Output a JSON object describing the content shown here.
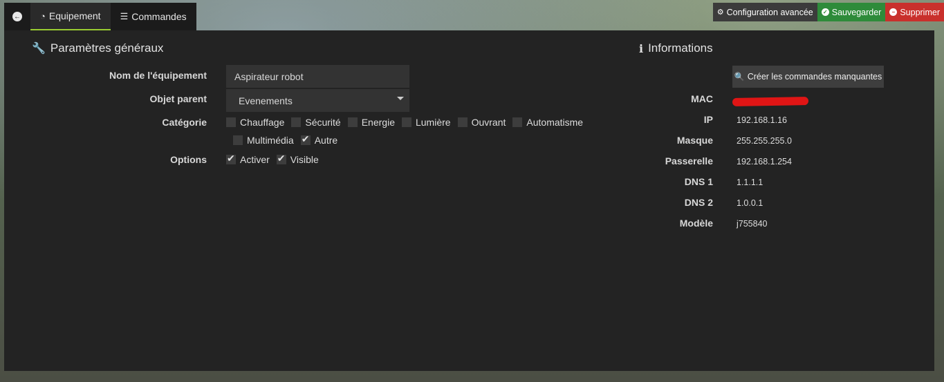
{
  "tabs": {
    "back_icon": "arrow-left-circle-icon",
    "equipment_label": "Equipement",
    "equipment_icon": "gauge-icon",
    "commands_label": "Commandes",
    "commands_icon": "list-icon"
  },
  "actions": {
    "config_label": "Configuration avancée",
    "save_label": "Sauvegarder",
    "delete_label": "Supprimer",
    "colors": {
      "save": "#2e8b3a",
      "delete": "#c9302c"
    }
  },
  "general": {
    "title": "Paramètres généraux",
    "name_label": "Nom de l'équipement",
    "name_value": "Aspirateur robot",
    "parent_label": "Objet parent",
    "parent_value": "Evenements",
    "category_label": "Catégorie",
    "categories": [
      {
        "label": "Chauffage",
        "checked": false
      },
      {
        "label": "Sécurité",
        "checked": false
      },
      {
        "label": "Energie",
        "checked": false
      },
      {
        "label": "Lumière",
        "checked": false
      },
      {
        "label": "Ouvrant",
        "checked": false
      },
      {
        "label": "Automatisme",
        "checked": false
      },
      {
        "label": "Multimédia",
        "checked": false
      },
      {
        "label": "Autre",
        "checked": true
      }
    ],
    "options_label": "Options",
    "options": [
      {
        "label": "Activer",
        "checked": true
      },
      {
        "label": "Visible",
        "checked": true
      }
    ]
  },
  "info": {
    "title": "Informations",
    "create_button": "Créer les commandes manquantes",
    "rows": [
      {
        "label": "MAC",
        "value": ""
      },
      {
        "label": "IP",
        "value": "192.168.1.16"
      },
      {
        "label": "Masque",
        "value": "255.255.255.0"
      },
      {
        "label": "Passerelle",
        "value": "192.168.1.254"
      },
      {
        "label": "DNS 1",
        "value": "1.1.1.1"
      },
      {
        "label": "DNS 2",
        "value": "1.0.0.1"
      },
      {
        "label": "Modèle",
        "value": "j755840"
      }
    ]
  }
}
